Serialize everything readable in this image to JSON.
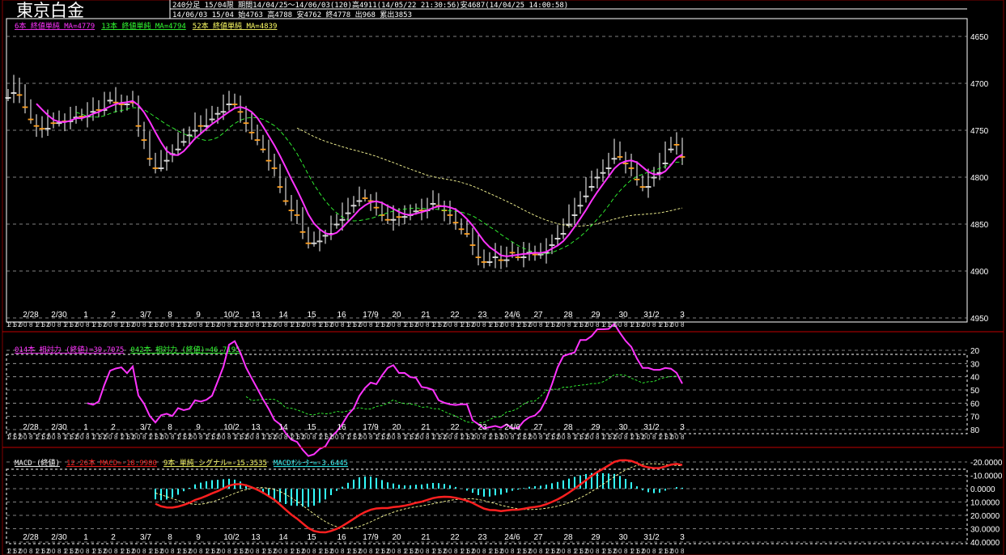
{
  "header": {
    "title": "東京白金",
    "line1": "240分足 15/04限 期間14/04/25～14/06/03(120)高4911(14/05/22 21:30:56)安4687(14/04/25 14:00:58)",
    "line2": "14/06/03 15/04 始4763 高4788 安4762 終4778 出968 累出3853"
  },
  "main_panel": {
    "legend": [
      {
        "text": "6本 終値単純 MA=4779",
        "color": "#ff33ff"
      },
      {
        "text": "13本 終値単純 MA=4794",
        "color": "#33ff33"
      },
      {
        "text": "52本 終値単純 MA=4839",
        "color": "#ffff66"
      }
    ],
    "y_ticks": [
      "4950",
      "4900",
      "4850",
      "4800",
      "4750",
      "4700",
      "4650"
    ]
  },
  "rsi_panel": {
    "legend": [
      {
        "text": "014本 相対力 (終値)=39.7075",
        "color": "#ff33ff"
      },
      {
        "text": "042本 相対力 (終値)=46.7195",
        "color": "#33ff33"
      }
    ],
    "y_ticks": [
      "80",
      "70",
      "60",
      "50",
      "40",
      "30",
      "20"
    ]
  },
  "macd_panel": {
    "legend": [
      {
        "text": "MACD (終値)",
        "color": "#ffffff"
      },
      {
        "text": "12-26本 MACD=-18.9980",
        "color": "#ff2020"
      },
      {
        "text": "9本 単純 シグナル=-15.3535",
        "color": "#ffff66"
      },
      {
        "text": "MACDｵｼﾚｰﾀｰ=-3.6445",
        "color": "#33ffff"
      }
    ],
    "y_ticks": [
      "40.0000",
      "30.0000",
      "20.0000",
      "10.0000",
      "0.0000",
      "-10.0000",
      "-20.0000"
    ]
  },
  "date_labels": [
    "2/28",
    "2/30",
    "1",
    "2",
    "3/7",
    "8",
    "9",
    "10/2",
    "13",
    "14",
    "15",
    "16",
    "17/9",
    "20",
    "21",
    "22",
    "23",
    "24/6",
    "27",
    "28",
    "29",
    "30",
    "31/2",
    "3"
  ],
  "hour_labels": [
    "12",
    "16",
    "20",
    "0",
    "8"
  ],
  "colors": {
    "up": "#ffa020",
    "down": "#000000",
    "frame": "#ffffff",
    "separator": "#c00000",
    "grid": "#bbbbbb"
  },
  "chart_data": {
    "type": "candlestick",
    "bars": 120,
    "ylim": [
      4650,
      4950
    ],
    "close": [
      4710,
      4700,
      4712,
      4725,
      4738,
      4745,
      4748,
      4735,
      4742,
      4738,
      4740,
      4736,
      4732,
      4735,
      4730,
      4722,
      4728,
      4718,
      4715,
      4720,
      4722,
      4718,
      4720,
      4745,
      4760,
      4780,
      4790,
      4782,
      4775,
      4770,
      4762,
      4755,
      4750,
      4740,
      4745,
      4738,
      4732,
      4730,
      4722,
      4715,
      4722,
      4730,
      4742,
      4752,
      4760,
      4770,
      4782,
      4790,
      4810,
      4825,
      4835,
      4840,
      4858,
      4870,
      4868,
      4862,
      4860,
      4850,
      4845,
      4838,
      4830,
      4825,
      4820,
      4822,
      4825,
      4832,
      4840,
      4845,
      4838,
      4842,
      4840,
      4836,
      4832,
      4835,
      4828,
      4825,
      4830,
      4835,
      4840,
      4848,
      4855,
      4860,
      4872,
      4885,
      4890,
      4885,
      4880,
      4888,
      4878,
      4880,
      4885,
      4880,
      4878,
      4882,
      4880,
      4872,
      4865,
      4860,
      4850,
      4840,
      4830,
      4820,
      4810,
      4800,
      4795,
      4790,
      4780,
      4770,
      4778,
      4785,
      4790,
      4802,
      4810,
      4800,
      4795,
      4785,
      4770,
      4762,
      4765,
      4778
    ],
    "rsi_ylim": [
      20,
      80
    ],
    "macd_ylim": [
      -20,
      40
    ]
  }
}
